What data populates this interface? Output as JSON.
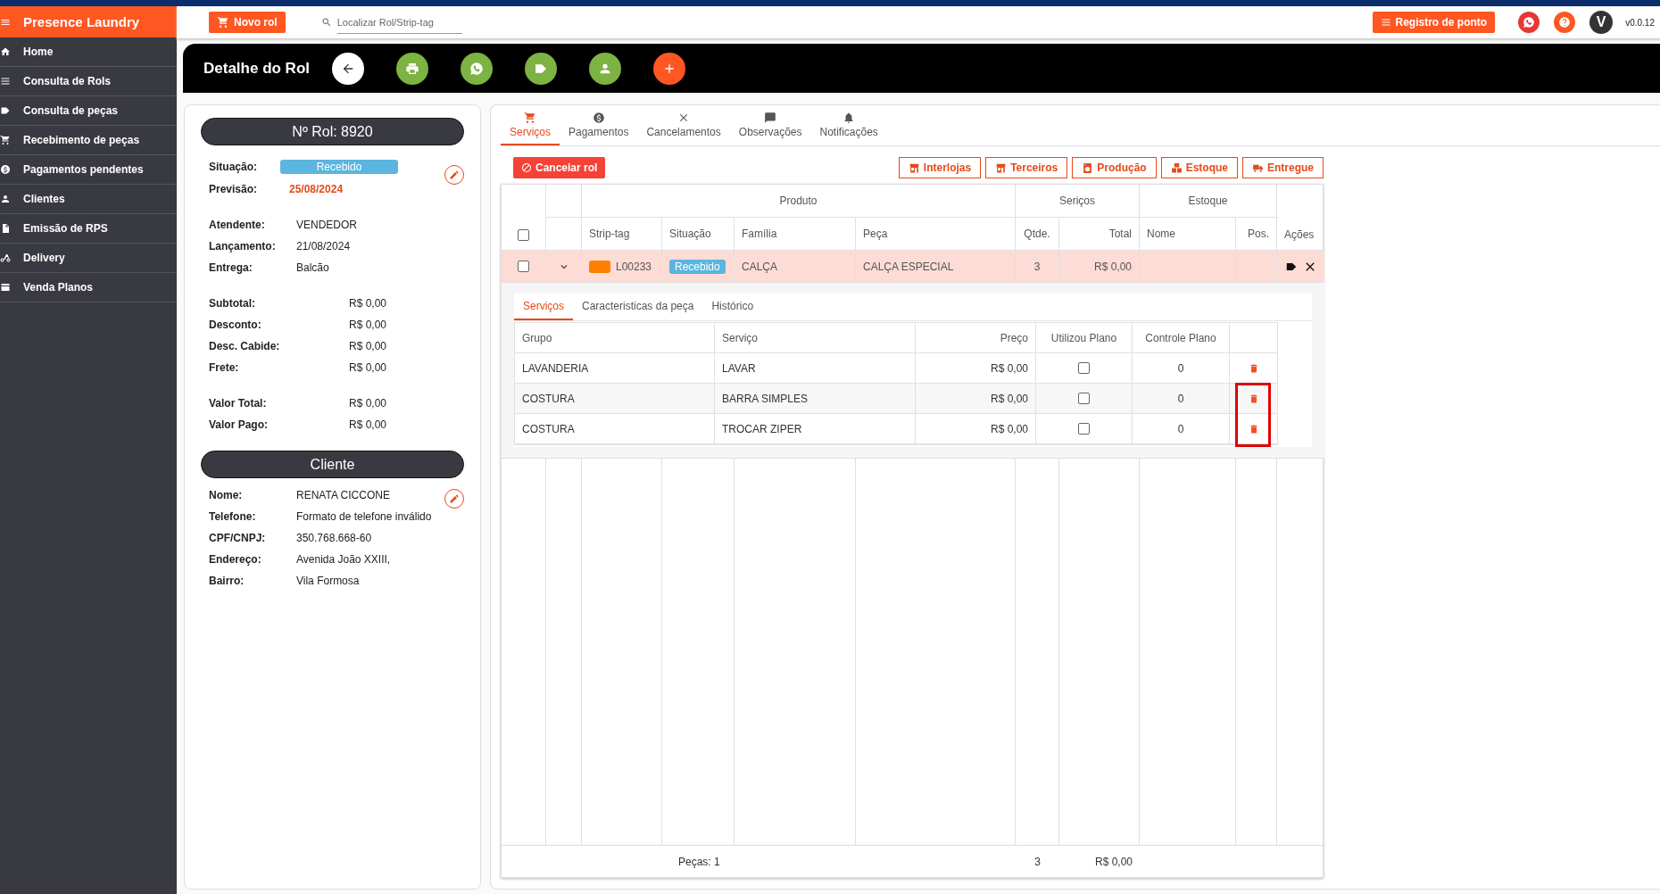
{
  "app": {
    "title": "Presence Laundry"
  },
  "sidebar": {
    "items": [
      {
        "label": "Home"
      },
      {
        "label": "Consulta de Rols"
      },
      {
        "label": "Consulta de peças"
      },
      {
        "label": "Recebimento de peças"
      },
      {
        "label": "Pagamentos pendentes"
      },
      {
        "label": "Clientes"
      },
      {
        "label": "Emissão de RPS"
      },
      {
        "label": "Delivery"
      },
      {
        "label": "Venda Planos"
      }
    ]
  },
  "topbar": {
    "new_button": "Novo rol",
    "search": {
      "placeholder": "Localizar Rol/Strip-tag"
    },
    "clock_button": "Registro de ponto",
    "avatar": "V",
    "version": "v0.0.12"
  },
  "header": {
    "title": "Detalhe do Rol"
  },
  "summary": {
    "title": "Nº Rol: 8920",
    "status_label": "Situação:",
    "status": "Recebido",
    "forecast_label": "Previsão:",
    "forecast": "25/08/2024",
    "details": [
      {
        "label": "Atendente:",
        "value": "VENDEDOR"
      },
      {
        "label": "Lançamento:",
        "value": "21/08/2024"
      },
      {
        "label": "Entrega:",
        "value": "Balcão"
      }
    ],
    "totals": [
      {
        "label": "Subtotal:",
        "value": "R$ 0,00"
      },
      {
        "label": "Desconto:",
        "value": "R$ 0,00"
      },
      {
        "label": "Desc. Cabide:",
        "value": "R$ 0,00"
      },
      {
        "label": "Frete:",
        "value": "R$ 0,00"
      }
    ],
    "payments": [
      {
        "label": "Valor Total:",
        "value": "R$ 0,00"
      },
      {
        "label": "Valor Pago:",
        "value": "R$ 0,00"
      }
    ]
  },
  "client": {
    "title": "Cliente",
    "fields": [
      {
        "label": "Nome:",
        "value": "RENATA CICCONE"
      },
      {
        "label": "Telefone:",
        "value": "Formato de telefone inválido"
      },
      {
        "label": "CPF/CNPJ:",
        "value": "350.768.668-60"
      },
      {
        "label": "Endereço:",
        "value": "Avenida João XXIII,"
      },
      {
        "label": "Bairro:",
        "value": "Vila Formosa"
      }
    ]
  },
  "tabs": [
    {
      "label": "Serviços",
      "selected": true
    },
    {
      "label": "Pagamentos",
      "selected": false
    },
    {
      "label": "Cancelamentos",
      "selected": false
    },
    {
      "label": "Observações",
      "selected": false
    },
    {
      "label": "Notificações",
      "selected": false
    }
  ],
  "cancel_button": "Cancelar rol",
  "action_buttons": [
    "Interlojas",
    "Terceiros",
    "Produção",
    "Estoque",
    "Entregue"
  ],
  "table": {
    "groups": [
      "Produto",
      "Seriços",
      "Estoque"
    ],
    "columns": [
      "Strip-tag",
      "Situação",
      "Família",
      "Peça",
      "Qtde.",
      "Total",
      "Nome",
      "Pos.",
      "Ações"
    ],
    "all_checked": false,
    "rows": [
      {
        "checked": false,
        "expanded": true,
        "color": "#ff8000",
        "strip_tag": "L00233",
        "status": "Recebido",
        "family": "CALÇA",
        "piece": "CALÇA ESPECIAL",
        "qty": "3",
        "total": "R$ 0,00",
        "detail": {
          "tabs": [
            {
              "label": "Serviços",
              "selected": true
            },
            {
              "label": "Caracteristicas da peça",
              "selected": false
            },
            {
              "label": "Histórico",
              "selected": false
            }
          ],
          "columns": [
            "Grupo",
            "Serviço",
            "Preço",
            "Utilizou Plano",
            "Controle Plano"
          ],
          "rows": [
            {
              "group": "LAVANDERIA",
              "service": "LAVAR",
              "price": "R$ 0,00",
              "used_plan": false,
              "plan_control": "0",
              "highlighted": false
            },
            {
              "group": "COSTURA",
              "service": "BARRA SIMPLES",
              "price": "R$ 0,00",
              "used_plan": false,
              "plan_control": "0",
              "highlighted": true
            },
            {
              "group": "COSTURA",
              "service": "TROCAR ZIPER",
              "price": "R$ 0,00",
              "used_plan": false,
              "plan_control": "0",
              "highlighted": true
            }
          ]
        }
      }
    ],
    "footer": {
      "label": "Peças: 1",
      "qty": "3",
      "total": "R$ 0,00"
    }
  }
}
